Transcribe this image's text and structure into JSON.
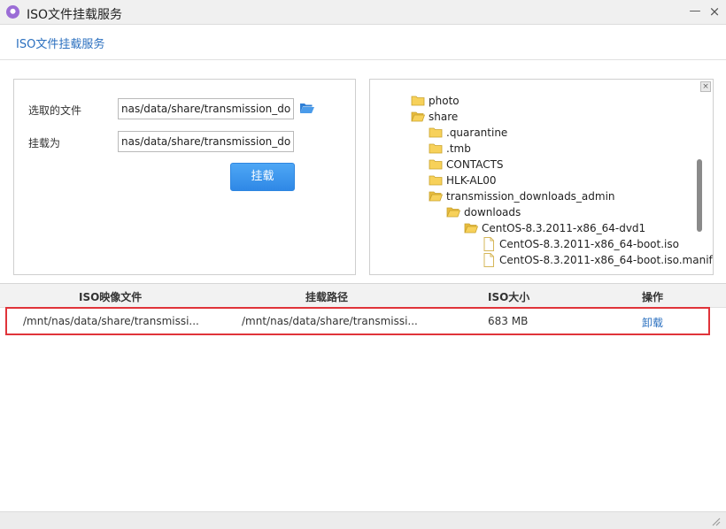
{
  "window": {
    "title": "ISO文件挂载服务",
    "minimize_icon": "minimize-icon",
    "close_icon": "close-icon"
  },
  "header": {
    "title": "ISO文件挂载服务"
  },
  "form": {
    "selected_file_label": "选取的文件",
    "selected_file_value": "nas/data/share/transmission_down",
    "mount_as_label": "挂载为",
    "mount_as_value": "nas/data/share/transmission_down",
    "browse_icon": "folder-open-icon",
    "mount_button": "挂载"
  },
  "tree": {
    "close_icon": "close-icon",
    "items": [
      {
        "label": "photo",
        "icon": "folder-icon"
      },
      {
        "label": "share",
        "icon": "folder-open-icon"
      },
      {
        "label": ".quarantine",
        "icon": "folder-icon"
      },
      {
        "label": ".tmb",
        "icon": "folder-icon"
      },
      {
        "label": "CONTACTS",
        "icon": "folder-icon"
      },
      {
        "label": "HLK-AL00",
        "icon": "folder-icon"
      },
      {
        "label": "transmission_downloads_admin",
        "icon": "folder-open-icon"
      },
      {
        "label": "downloads",
        "icon": "folder-open-icon"
      },
      {
        "label": "CentOS-8.3.2011-x86_64-dvd1",
        "icon": "folder-open-icon"
      },
      {
        "label": "CentOS-8.3.2011-x86_64-boot.iso",
        "icon": "file-icon"
      },
      {
        "label": "CentOS-8.3.2011-x86_64-boot.iso.manif",
        "icon": "file-icon"
      }
    ]
  },
  "table": {
    "headers": {
      "iso": "ISO映像文件",
      "path": "挂载路径",
      "size": "ISO大小",
      "op": "操作"
    },
    "rows": [
      {
        "iso": "/mnt/nas/data/share/transmissi...",
        "path": "/mnt/nas/data/share/transmissi...",
        "size": "683 MB",
        "op": "卸载"
      }
    ]
  },
  "colors": {
    "accent": "#2a6fbf",
    "button": "#3a95ec",
    "highlight_border": "#e0343a",
    "folder": "#f4c542"
  }
}
